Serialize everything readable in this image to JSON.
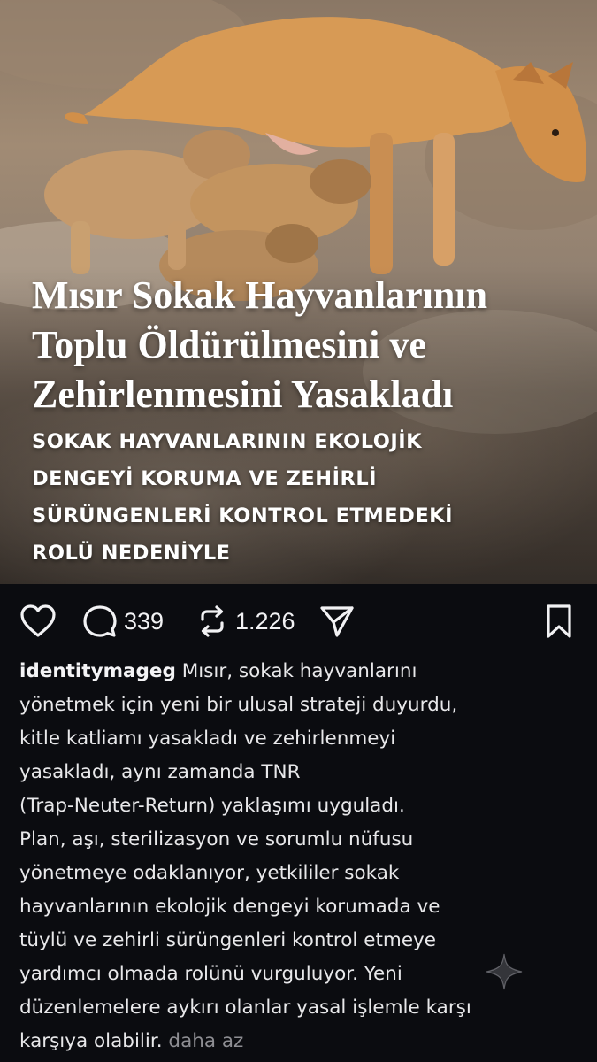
{
  "post": {
    "headline_lines": [
      "Mısır Sokak Hayvanlarının",
      "Toplu Öldürülmesini ve",
      "Zehirlenmesini Yasakladı"
    ],
    "subhead_lines": [
      "SOKAK HAYVANLARININ EKOLOJİK",
      "DENGEYİ KORUMA VE ZEHİRLİ",
      "SÜRÜNGENLERİ KONTROL ETMEDEKİ",
      "ROLÜ NEDENİYLE"
    ]
  },
  "actions": {
    "like_icon": "heart-icon",
    "comment_icon": "comment-icon",
    "comment_count": "339",
    "repost_icon": "repost-icon",
    "repost_count": "1.226",
    "share_icon": "send-icon",
    "save_icon": "bookmark-icon"
  },
  "caption": {
    "username": "identitymageg",
    "first_line_rest": " Mısır, sokak hayvanlarını",
    "lines": [
      "yönetmek için yeni bir ulusal strateji duyurdu,",
      "kitle katliamı yasakladı ve zehirlenmeyi",
      "yasakladı, aynı zamanda TNR",
      "(Trap-Neuter-Return) yaklaşımı uyguladı.",
      "Plan, aşı, sterilizasyon ve sorumlu nüfusu",
      "yönetmeye odaklanıyor, yetkililer sokak",
      "hayvanlarının ekolojik dengeyi korumada ve",
      "tüylü ve zehirli sürüngenleri kontrol etmeye",
      "yardımcı olmada rolünü vurguluyor. Yeni",
      "düzenlemelere aykırı olanlar yasal işlemle karşı"
    ],
    "last_line": "karşıya olabilir.",
    "less_link": "daha az"
  },
  "colors": {
    "background": "#0b0c10",
    "text": "#e9e9ec",
    "muted": "#8e8e93"
  }
}
